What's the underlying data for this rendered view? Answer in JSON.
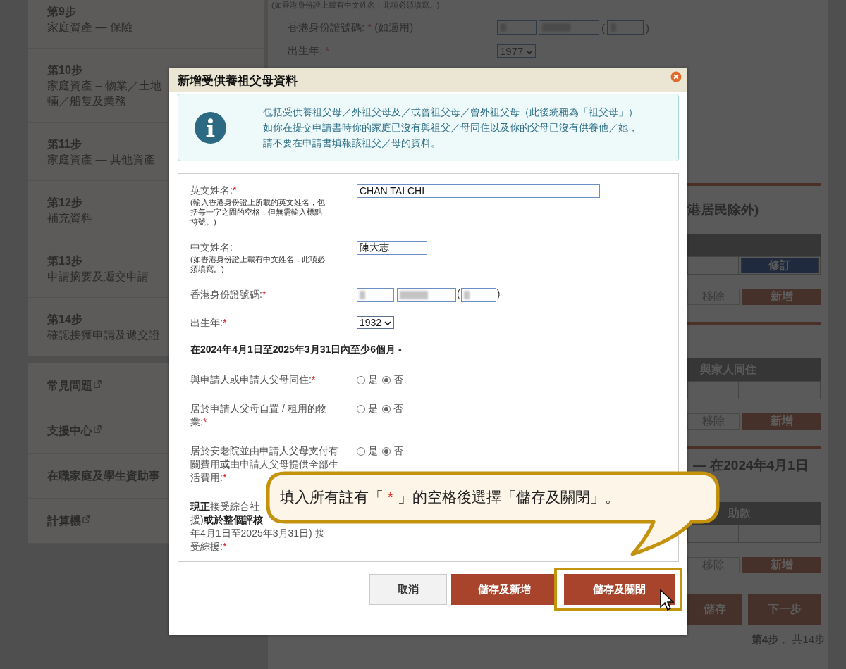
{
  "sidebar": {
    "steps": [
      {
        "step": "第9步",
        "lines": [
          "家庭資產 — 保險"
        ]
      },
      {
        "step": "第10步",
        "lines": [
          "家庭資產 – 物業／土地",
          "輛／船隻及業務"
        ]
      },
      {
        "step": "第11步",
        "lines": [
          "家庭資產 — 其他資產"
        ]
      },
      {
        "step": "第12步",
        "lines": [
          "補充資料"
        ]
      },
      {
        "step": "第13步",
        "lines": [
          "申請摘要及遞交申請"
        ]
      },
      {
        "step": "第14步",
        "lines": [
          "確認接獲申請及遞交證"
        ]
      }
    ],
    "links": [
      {
        "label": "常見問題",
        "external": true
      },
      {
        "label": "支援中心",
        "external": true
      },
      {
        "label": "在職家庭及學生資助事",
        "external": false
      },
      {
        "label": "計算機",
        "external": true
      }
    ]
  },
  "background_form": {
    "hint": "(如香港身份證上載有中文姓名，此項必須填寫。)",
    "id_label": "香港身份證號碼:",
    "id_mark": "*",
    "id_note": "(如適用)",
    "id_open": "(",
    "id_close": ")",
    "birth_label": "出生年:",
    "birth_mark": "*",
    "birth_year": "1977"
  },
  "background_sections": [
    {
      "heading": "港居民除外)",
      "row_action": "修訂",
      "buttons": [
        "移除",
        "新增"
      ]
    },
    {
      "column": "與家人同住",
      "buttons": [
        "移除",
        "新增"
      ]
    },
    {
      "heading": "— 在2024年4月1日",
      "column": "助款",
      "buttons": [
        "移除",
        "新增"
      ]
    }
  ],
  "page_buttons": [
    "儲存",
    "下一步"
  ],
  "page_progress": "**第4步**， 共14步",
  "modal": {
    "title": "新增受供養祖父母資料",
    "info_lines": [
      "包括受供養祖父母／外祖父母及／或曾祖父母／曾外祖父母（此後統稱為「祖父母」）",
      "如你在提交申請書時你的家庭已沒有與祖父／母同住以及你的父母已沒有供養他／她，",
      "請不要在申請書填報該祖父／母的資料。"
    ],
    "fields": [
      {
        "kind": "long_text",
        "label": "英文姓名:",
        "mark": "*",
        "hint": "(輸入香港身份證上所載的英文姓名，包括每一字之間的空格，但無需輸入標點符號。)",
        "value": "CHAN TAI CHI"
      },
      {
        "kind": "short_text",
        "label": "中文姓名:",
        "hint": "(如香港身份證上載有中文姓名，此項必須填寫。)",
        "value": "陳大志"
      },
      {
        "kind": "id",
        "label": "香港身份證號碼:",
        "mark": "*",
        "open": "(",
        "close": ")"
      },
      {
        "kind": "select",
        "label": "出生年:",
        "mark": "*",
        "value": "1932"
      },
      {
        "kind": "heading",
        "label": "在2024年4月1日至2025年3月31日內至少6個月 -"
      },
      {
        "kind": "radio",
        "label": "與申請人或申請人父母同住:",
        "mark": "*",
        "options": [
          {
            "label": "是",
            "selected": false
          },
          {
            "label": "否",
            "selected": true
          }
        ]
      },
      {
        "kind": "radio",
        "label": "居於申請人父母自置 / 租用的物業:",
        "mark": "*",
        "options": [
          {
            "label": "是",
            "selected": false
          },
          {
            "label": "否",
            "selected": true
          }
        ]
      },
      {
        "kind": "radio",
        "label": "居於安老院並由申請人父母支付有關費用**或**由申請人父母提供全部生活費用:",
        "mark": "*",
        "options": [
          {
            "label": "是",
            "selected": false
          },
          {
            "label": "否",
            "selected": true
          }
        ]
      },
      {
        "kind": "partial",
        "label_lines": [
          "**現正**接受綜合社",
          "援)**或於整個評核**",
          "年4月1日至2025年3月31日) 接",
          "受綜援:"
        ],
        "mark": "*"
      }
    ],
    "buttons": [
      {
        "label": "取消",
        "kind": "secondary",
        "highlighted": false
      },
      {
        "label": "儲存及新增",
        "kind": "primary",
        "highlighted": false
      },
      {
        "label": "儲存及關閉",
        "kind": "primary",
        "highlighted": true
      }
    ]
  },
  "callout": {
    "parts": [
      {
        "text": "填入所有註有「 ",
        "kind": "plain"
      },
      {
        "text": "*",
        "kind": "required"
      },
      {
        "text": " 」的空格後選擇「儲存及關閉」。",
        "kind": "plain"
      }
    ]
  }
}
